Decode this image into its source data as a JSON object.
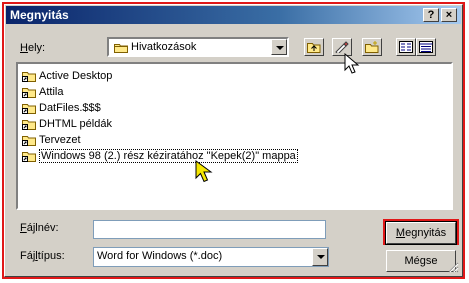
{
  "window": {
    "title": "Megnyitás",
    "help_btn": "?",
    "close_btn": "×"
  },
  "location": {
    "label_prefix": "",
    "label_underlined": "H",
    "label_rest": "ely:",
    "value": "Hivatkozások"
  },
  "files": [
    {
      "name": "Active Desktop",
      "selected": false
    },
    {
      "name": "Attila",
      "selected": false
    },
    {
      "name": "DatFiles.$$$",
      "selected": false
    },
    {
      "name": "DHTML példák",
      "selected": false
    },
    {
      "name": "Tervezet",
      "selected": false
    },
    {
      "name": "Windows 98 (2.) rész kéziratához \"Kepek(2)\" mappa",
      "selected": true
    }
  ],
  "filename": {
    "label_prefix": "",
    "label_underlined": "F",
    "label_rest": "ájlnév:",
    "value": ""
  },
  "filetype": {
    "label_prefix": "Fáj",
    "label_underlined": "l",
    "label_rest": "típus:",
    "value": "Word for Windows (*.doc)"
  },
  "buttons": {
    "open_underlined": "M",
    "open_rest": "egnyitás",
    "cancel": "Mégse"
  },
  "colors": {
    "highlight_border": "#e01818",
    "title_start": "#0a246a",
    "cursor_yellow": "#f5e600"
  }
}
